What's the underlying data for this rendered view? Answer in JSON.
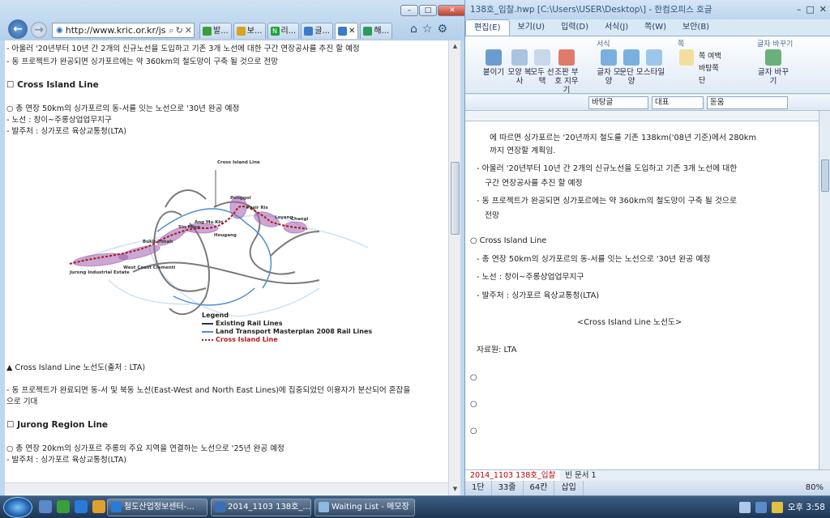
{
  "ie": {
    "address": "http://www.kric.or.kr/js",
    "tabs": [
      "발...",
      "보...",
      "리...",
      "글...",
      "",
      "해..."
    ],
    "content": {
      "l0": "- 아울러 '20년부터 10년 간 2개의 신규노선을 도입하고 기존 3개 노선에 대한 구간 연장공사를 추진 할 예정",
      "l1": "- 동 프로젝트가 완공되면 싱가포르에는 약 360km의 철도망이 구축 될 것으로 전망",
      "h1": "☐ Cross Island Line",
      "l2": "○ 총 연장 50km의 싱가포르의 동-서를 잇는 노선으로 '30년 완공 예정",
      "l3": "- 노선 : 창이~주롱상업업무지구",
      "l4": "- 발주처 : 싱가포르 육상교통청(LTA)",
      "caption": "▲ Cross Island Line 노선도(출처 : LTA)",
      "l5": "- 동 프로젝트가 완료되면 동-서 및 북동 노선(East-West and North East Lines)에 집중되었던 이용자가 분산되어 혼잡을",
      "l5b": "으로 기대",
      "h2": "☐ Jurong Region Line",
      "l6": "○ 총 연장 20km의 싱가포르 주롱의 주요 지역을 연결하는 노선으로 '25년 완공 예정",
      "l7": "- 발주처 : 싱가포르 육상교통청(LTA)"
    },
    "map": {
      "title": "Cross Island Line",
      "places": [
        "Punggol",
        "Pasir Ris",
        "Loyang",
        "Changi",
        "Sin Ming",
        "Ang Mo Kio",
        "Hougang",
        "Bukit Timah",
        "West Coast Clementi",
        "Jurong Industrial Estate"
      ],
      "legend_title": "Legend",
      "legend": [
        "Existing Rail Lines",
        "Land Transport Masterplan 2008 Rail Lines",
        "Cross Island Line"
      ]
    }
  },
  "hwp": {
    "title": "138호_입찰.hwp [C:\\Users\\USER\\Desktop\\] - 한컴오피스 호글",
    "menu": [
      "편집(E)",
      "보기(U)",
      "입력(D)",
      "서식(J)",
      "쪽(W)",
      "보안(B)"
    ],
    "ribbon_groups": [
      "서식",
      "쪽",
      "글자 바꾸기"
    ],
    "ribbon": [
      "붙이기",
      "모양 복사",
      "모두 선택",
      "조판 부호 지우기",
      "글자 모양",
      "문단 모양",
      "스타일",
      "쪽 여백",
      "바탕쪽",
      "단",
      "글자 바꾸기"
    ],
    "style_combo": "바탕글",
    "font_combo1": "대표",
    "font_combo2": "돋움",
    "doc": {
      "d0": "에 따르면 싱가포르는 '20년까지 철도를 기존 138km('08년 기준)에서 280km",
      "d1": "까지 연장할 계획임.",
      "d2": "- 아울러 '20년부터 10년 간 2개의 신규노선을 도입하고 기존 3개 노선에 대한",
      "d3": "구간 연장공사를 추진 할 예정",
      "d4": "- 동 프로젝트가 완공되면 싱가포르에는 약 360km의 철도망이 구축 될 것으로",
      "d5": "전망",
      "d6": "○ Cross Island Line",
      "d7": "- 총 연장 50km의 싱가포르의 동-서를 잇는 노선으로 '30년 완공 예정",
      "d8": "- 노선 : 창이~주롱상업업무지구",
      "d9": "- 발주처 : 싱가포르 육상교통청(LTA)",
      "d10": "<Cross Island Line 노선도>",
      "d11": "자료원: LTA",
      "d12": "○",
      "d13": "○",
      "d14": "○"
    },
    "doctabs": [
      "2014_1103 138호_입찰",
      "빈 문서 1"
    ],
    "status": [
      "1단",
      "33줄",
      "64칸",
      "삽입"
    ],
    "zoom": "80%"
  },
  "taskbar": {
    "items": [
      "철도산업정보센터-...",
      "2014_1103 138호_...",
      "Waiting List - 메모장"
    ],
    "clock": "오후 3:58"
  }
}
